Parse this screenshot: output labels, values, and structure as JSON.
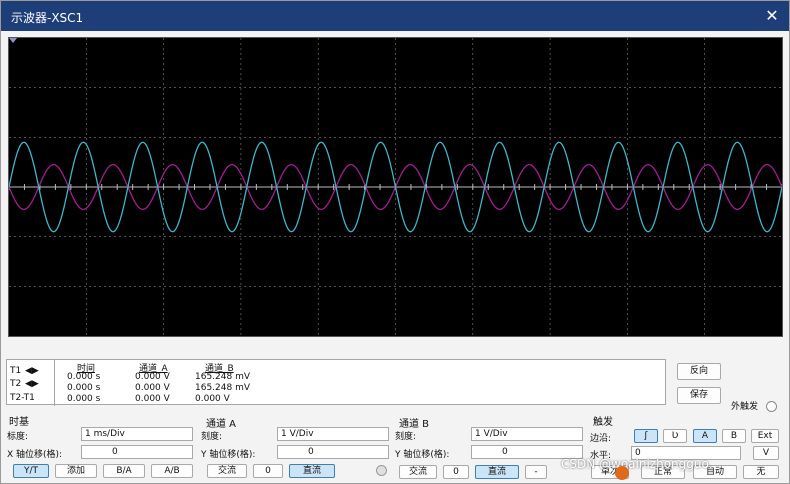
{
  "window": {
    "title": "示波器-XSC1",
    "close_icon": "close-icon"
  },
  "readout": {
    "row_labels": [
      "T1",
      "T2",
      "T2-T1"
    ],
    "col_headers": [
      "时间",
      "通道_A",
      "通道_B"
    ],
    "rows": [
      [
        "0.000 s",
        "0.000 V",
        "165.248 mV"
      ],
      [
        "0.000 s",
        "0.000 V",
        "165.248 mV"
      ],
      [
        "0.000 s",
        "0.000 V",
        "0.000 V"
      ]
    ],
    "reverse": "反向",
    "save": "保存",
    "ext_trigger": "外触发"
  },
  "timebase": {
    "title": "时基",
    "scale_label": "标度:",
    "scale_value": "1 ms/Div",
    "xpos_label": "X 轴位移(格):",
    "xpos_value": "0",
    "buttons": [
      "Y/T",
      "添加",
      "B/A",
      "A/B"
    ]
  },
  "channel_a": {
    "title": "通道 A",
    "scale_label": "刻度:",
    "scale_value": "1  V/Div",
    "ypos_label": "Y 轴位移(格):",
    "ypos_value": "0",
    "coupling": [
      "交流",
      "0",
      "直流"
    ]
  },
  "channel_b": {
    "title": "通道 B",
    "scale_label": "刻度:",
    "scale_value": "1  V/Div",
    "ypos_label": "Y 轴位移(格):",
    "ypos_value": "0",
    "coupling": [
      "交流",
      "0",
      "直流",
      "-"
    ]
  },
  "trigger": {
    "title": "触发",
    "edge_label": "边沿:",
    "edge_buttons": [
      "ʃ",
      "Ʋ"
    ],
    "source_buttons": [
      "A",
      "B",
      "Ext"
    ],
    "level_label": "水平:",
    "level_value": "0",
    "level_unit": "V",
    "mode_buttons": [
      "单次",
      "正常",
      "自动",
      "无"
    ]
  },
  "watermark": "CSDN @woainizhongguo.",
  "colors": {
    "channel_a": "#3fb6c8",
    "channel_b": "#a0208e",
    "grid": "#808080",
    "screen": "#000000"
  },
  "waveform": {
    "time_per_div_ms": 1,
    "channel_a": {
      "type": "sine",
      "amplitude_div": 0.9,
      "cycles_visible": 13
    },
    "channel_b": {
      "type": "sine",
      "amplitude_div": 0.45,
      "cycles_visible": 13
    }
  }
}
